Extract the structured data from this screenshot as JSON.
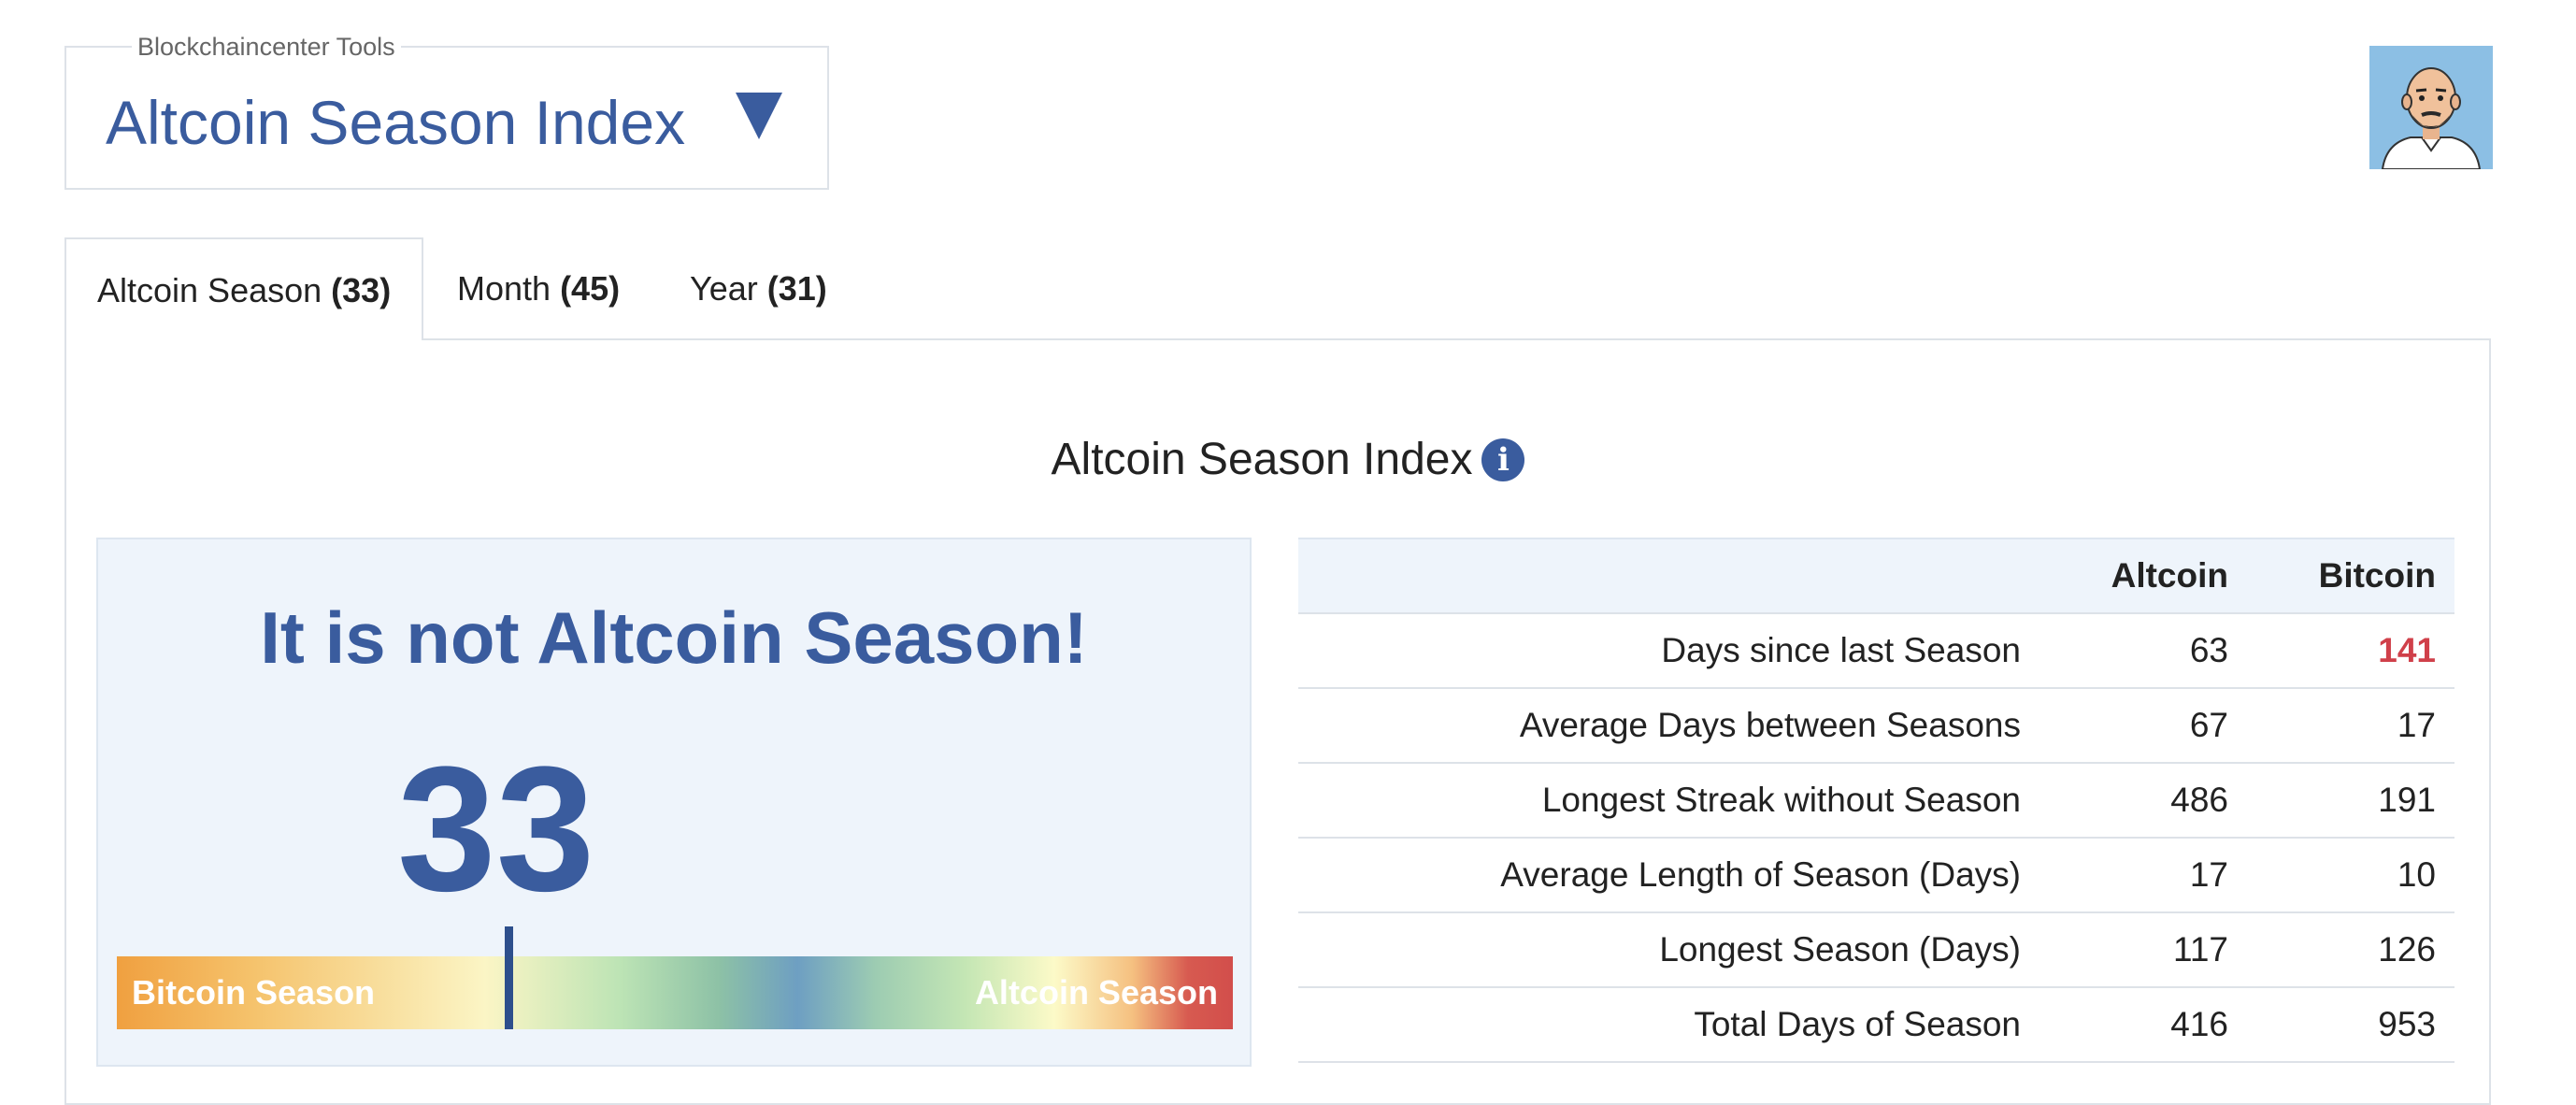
{
  "tool_selector": {
    "legend": "Blockchaincenter Tools",
    "title": "Altcoin Season Index",
    "caret_icon": "caret-down-icon"
  },
  "tabs": [
    {
      "label": "Altcoin Season ",
      "count": "(33)",
      "active": true
    },
    {
      "label": "Month ",
      "count": "(45)",
      "active": false
    },
    {
      "label": "Year ",
      "count": "(31)",
      "active": false
    }
  ],
  "section": {
    "title": "Altcoin Season Index",
    "info_icon": "i"
  },
  "gauge": {
    "verdict": "It is not Altcoin Season!",
    "value": "33",
    "value_fraction": 0.33,
    "left_label": "Bitcoin Season",
    "right_label": "Altcoin Season"
  },
  "stats": {
    "headers": [
      "",
      "Altcoin",
      "Bitcoin"
    ],
    "rows": [
      {
        "label": "Days since last Season",
        "altcoin": "63",
        "bitcoin": "141",
        "highlight": "bitcoin"
      },
      {
        "label": "Average Days between Seasons",
        "altcoin": "67",
        "bitcoin": "17"
      },
      {
        "label": "Longest Streak without Season",
        "altcoin": "486",
        "bitcoin": "191"
      },
      {
        "label": "Average Length of Season (Days)",
        "altcoin": "17",
        "bitcoin": "10"
      },
      {
        "label": "Longest Season (Days)",
        "altcoin": "117",
        "bitcoin": "126"
      },
      {
        "label": "Total Days of Season",
        "altcoin": "416",
        "bitcoin": "953"
      }
    ]
  },
  "colors": {
    "brand_blue": "#3a5c9e",
    "highlight_red": "#d0404a",
    "card_bg": "#eef4fb"
  }
}
